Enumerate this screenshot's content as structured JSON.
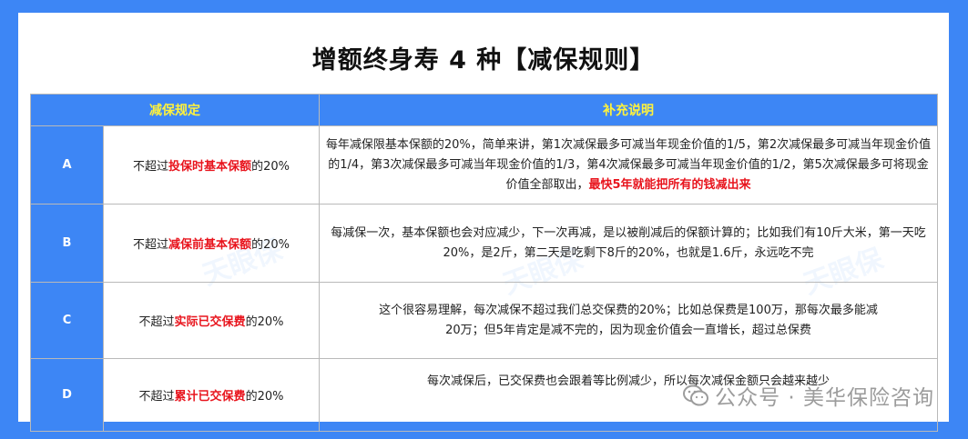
{
  "title": "增额终身寿 4 种【减保规则】",
  "header": {
    "col_rule": "减保规定",
    "col_desc": "补充说明"
  },
  "rows": [
    {
      "letter": "A",
      "rule_pre": "不超过",
      "rule_hl": "投保时基本保额",
      "rule_post": "的20%",
      "desc_text": "每年减保限基本保额的20%，简单来讲，第1次减保最多可减当年现金价值的1/5，第2次减保最多可减当年现金价值的1/4，第3次减保最多可减当年现金价值的1/3，第4次减保最多可减当年现金价值的1/2，第5次减保最多可将现金价值全部取出，",
      "desc_hl": "最快5年就能把所有的钱减出来"
    },
    {
      "letter": "B",
      "rule_pre": "不超过",
      "rule_hl": "减保前基本保额",
      "rule_post": "的20%",
      "desc_text": "每减保一次，基本保额也会对应减少，下一次再减，是以被削减后的保额计算的；比如我们有10斤大米，第一天吃20%，是2斤，第二天是吃剩下8斤的20%，也就是1.6斤，永远吃不完",
      "desc_hl": ""
    },
    {
      "letter": "C",
      "rule_pre": "不超过",
      "rule_hl": "实际已交保费",
      "rule_post": "的20%",
      "desc_text": "这个很容易理解，每次减保不超过我们总交保费的20%；比如总保费是100万，那每次最多能减20万；但5年肯定是减不完的，因为现金价值会一直增长，超过总保费",
      "desc_hl": ""
    },
    {
      "letter": "D",
      "rule_pre": "不超过",
      "rule_hl": "累计已交保费",
      "rule_post": "的20%",
      "desc_text": "每次减保后，已交保费也会跟着等比例减少，所以每次减保金额只会越来越少",
      "desc_hl": ""
    }
  ],
  "watermark": "公众号 · 美华保险咨询",
  "stamp": "天眼保",
  "colors": {
    "accent": "#3d86f5",
    "header_text": "#fff23c",
    "highlight": "#e8141d"
  }
}
